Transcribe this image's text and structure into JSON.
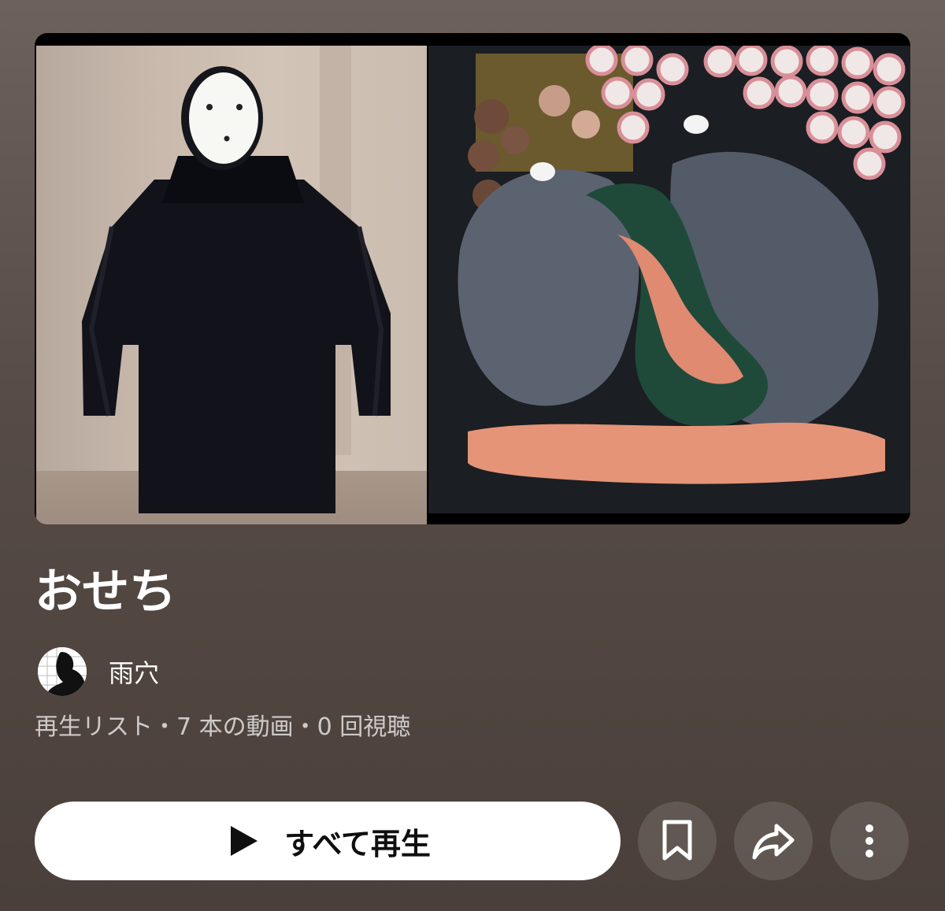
{
  "playlist": {
    "title": "おせち",
    "channel_name": "雨穴",
    "meta": "再生リスト・7 本の動画・0 回視聴"
  },
  "actions": {
    "play_all_label": "すべて再生",
    "play_icon": "play-icon",
    "save_icon": "bookmark-icon",
    "share_icon": "share-icon",
    "more_icon": "more-vertical-icon"
  },
  "colors": {
    "background": "#564b45",
    "play_button": "#ffffff",
    "round_button": "rgba(255,255,255,0.12)"
  }
}
